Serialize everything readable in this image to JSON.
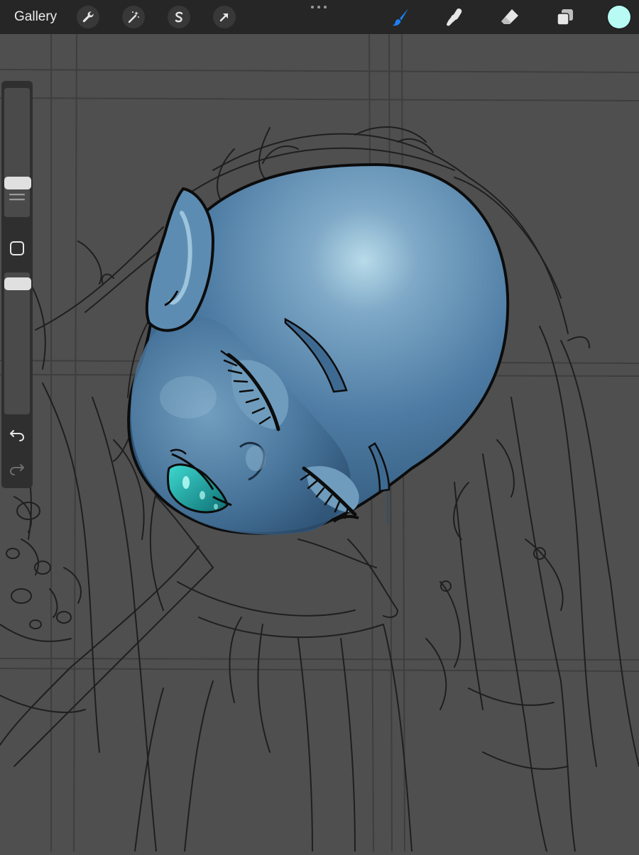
{
  "toolbar": {
    "gallery_label": "Gallery",
    "left_tools": [
      {
        "name": "actions-wrench",
        "icon": "wrench-icon"
      },
      {
        "name": "adjustments-magic-wand",
        "icon": "magic-wand-icon"
      },
      {
        "name": "selection-s",
        "icon": "selection-icon"
      },
      {
        "name": "transform-arrow",
        "icon": "transform-arrow-icon"
      }
    ],
    "right_tools": [
      {
        "name": "brush",
        "icon": "brush-icon",
        "active": true
      },
      {
        "name": "smudge",
        "icon": "smudge-finger-icon",
        "active": false
      },
      {
        "name": "eraser",
        "icon": "eraser-icon",
        "active": false
      },
      {
        "name": "layers",
        "icon": "layers-icon",
        "active": false
      }
    ],
    "active_color": "#b8fbf4",
    "accent_color": "#1e7ff0"
  },
  "sidebar": {
    "brush_size_level": 0.24,
    "opacity_level": 0.96
  },
  "canvas": {
    "background_color": "#4f4f4f",
    "skin_color": "#4d7ba3",
    "lip_color": "#1bb7b0"
  }
}
